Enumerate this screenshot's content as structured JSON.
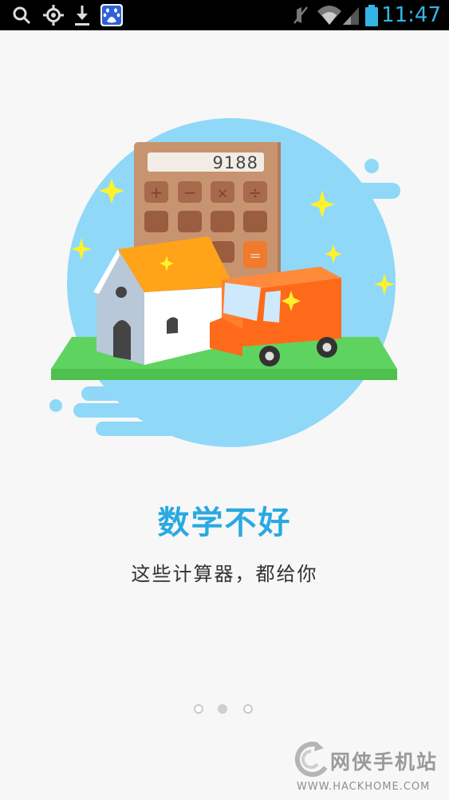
{
  "status_bar": {
    "time": "11:47",
    "icons": [
      "search-icon",
      "gps-icon",
      "download-icon",
      "baidu-app-icon",
      "mute-icon",
      "wifi-icon",
      "signal-icon",
      "battery-icon"
    ],
    "accent": "#33b5e5"
  },
  "illustration": {
    "calculator_display": "9188",
    "calculator_keys": [
      "+",
      "−",
      "×",
      "÷",
      "="
    ]
  },
  "onboarding": {
    "title": "数学不好",
    "subtitle": "这些计算器，都给你"
  },
  "pager": {
    "current_page": 2,
    "page_count": 3
  },
  "watermark": {
    "title": "网侠手机站",
    "url": "WWW.HACKHOME.COM"
  },
  "colors": {
    "title": "#29a9e1",
    "blob": "#8fd8f8",
    "grass": "#5fd35f",
    "roof": "#ffa318",
    "truck": "#ff6a1a",
    "calculator": "#c8946f"
  }
}
